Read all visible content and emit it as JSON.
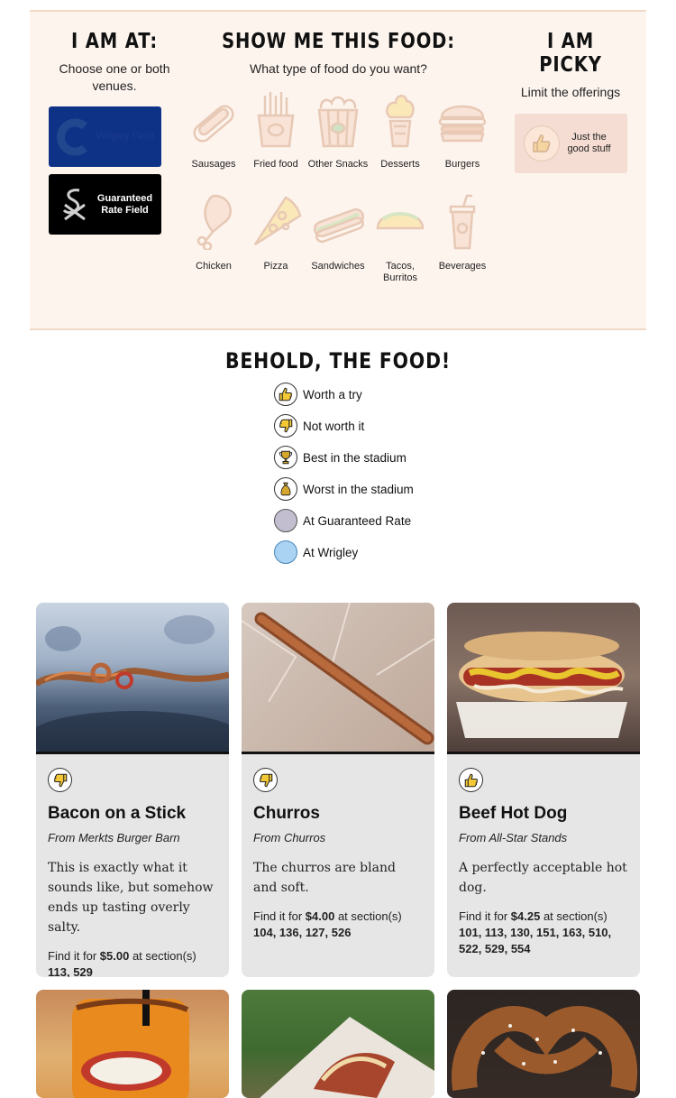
{
  "venue": {
    "title": "I am at:",
    "subtitle": "Choose one or both venues.",
    "options": [
      {
        "label": "Wrigley Field",
        "icon": "cubs-logo-icon"
      },
      {
        "label": "Guaranteed Rate Field",
        "icon": "white-sox-logo-icon"
      }
    ]
  },
  "food": {
    "title": "Show me this food:",
    "subtitle": "What type of food do you want?",
    "items": [
      {
        "label": "Sausages",
        "icon": "sausage-icon"
      },
      {
        "label": "Fried food",
        "icon": "fries-icon"
      },
      {
        "label": "Other Snacks",
        "icon": "popcorn-icon"
      },
      {
        "label": "Desserts",
        "icon": "ice-cream-icon"
      },
      {
        "label": "Burgers",
        "icon": "burger-icon"
      },
      {
        "label": "Chicken",
        "icon": "chicken-leg-icon"
      },
      {
        "label": "Pizza",
        "icon": "pizza-slice-icon"
      },
      {
        "label": "Sandwiches",
        "icon": "sandwich-icon"
      },
      {
        "label": "Tacos, Burritos",
        "icon": "taco-icon"
      },
      {
        "label": "Beverages",
        "icon": "drink-cup-icon"
      }
    ]
  },
  "picky": {
    "title": "I am picky",
    "subtitle": "Limit the offerings",
    "button_label": "Just the good stuff",
    "icon": "thumbs-up-icon"
  },
  "legend": {
    "title": "Behold, the food!",
    "items": [
      {
        "label": "Worth a try",
        "icon": "thumbs-up-icon"
      },
      {
        "label": "Not worth it",
        "icon": "thumbs-down-icon"
      },
      {
        "label": "Best in the stadium",
        "icon": "trophy-icon"
      },
      {
        "label": "Worst in the stadium",
        "icon": "bag-icon"
      },
      {
        "label": "At Guaranteed Rate",
        "color": "#c3bdd0"
      },
      {
        "label": "At Wrigley",
        "color": "#a9d2f3"
      }
    ]
  },
  "cards": [
    {
      "name": "Bacon on a Stick",
      "vendor": "From Merkts Burger Barn",
      "rating": "thumbs-down-icon",
      "description": "This is exactly what it sounds like, but somehow ends up tasting overly salty.",
      "price_prefix": "Find it for ",
      "price": "$5.00",
      "price_suffix": " at section(s)",
      "sections": "113, 529"
    },
    {
      "name": "Churros",
      "vendor": "From Churros",
      "rating": "thumbs-down-icon",
      "description": "The churros are bland and soft.",
      "price_prefix": "Find it for ",
      "price": "$4.00",
      "price_suffix": " at section(s)",
      "sections": "104, 136, 127, 526"
    },
    {
      "name": "Beef Hot Dog",
      "vendor": "From All-Star Stands",
      "rating": "thumbs-up-icon",
      "description": "A perfectly acceptable hot dog.",
      "price_prefix": "Find it for ",
      "price": "$4.25",
      "price_suffix": " at section(s)",
      "sections": "101, 113, 130, 151, 163, 510, 522, 529, 554"
    }
  ],
  "colors": {
    "panel_bg": "#fdf4ee",
    "wrigley_blue": "#0e3386",
    "grf_black": "#000000",
    "card_bg": "#e6e6e6",
    "icon_stroke": "#e7c9b5"
  }
}
